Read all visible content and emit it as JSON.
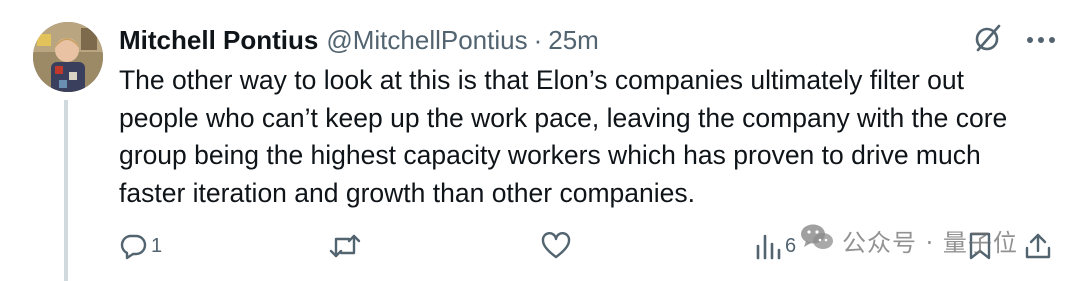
{
  "tweet": {
    "author_name": "Mitchell Pontius",
    "handle": "@MitchellPontius",
    "separator": "·",
    "time": "25m",
    "text": "The other way to look at this is that Elon’s companies ultimately filter out people who can’t keep up the work pace, leaving the company with the core group being the highest capacity workers which has proven to drive much faster iteration and growth than other companies."
  },
  "actions": {
    "reply_count": "1",
    "retweet_count": "",
    "like_count": "",
    "views_count": "6"
  },
  "watermark": {
    "text": "公众号 · 量子位"
  },
  "icons": {
    "grok": "grok-slash-icon",
    "more": "more-dots-icon",
    "reply": "reply-icon",
    "retweet": "retweet-icon",
    "like": "heart-icon",
    "views": "views-bars-icon",
    "bookmark": "bookmark-icon",
    "share": "share-icon",
    "wechat": "wechat-icon"
  },
  "colors": {
    "text": "#0f1419",
    "secondary": "#536471",
    "thread_line": "#cfd9de"
  }
}
